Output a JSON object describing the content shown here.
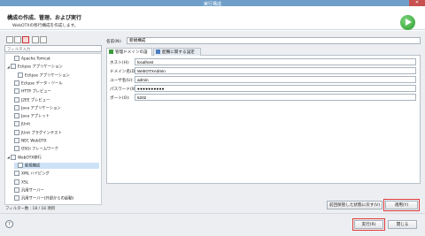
{
  "window": {
    "title": "実行構成",
    "close_glyph": "✕"
  },
  "header": {
    "title": "構成の作成、管理、および実行",
    "subtitle": "WebOTXの移行構成を作成します。"
  },
  "left_pane": {
    "filter_placeholder": "フィルタ入力",
    "tree": [
      {
        "label": "Apache Tomcat",
        "level": 1,
        "twisty": "",
        "icon": "server-icon"
      },
      {
        "label": "Eclipse アプリケーション",
        "level": 0,
        "twisty": "◢",
        "icon": "eclipse-icon"
      },
      {
        "label": "Eclipse アプリケーション",
        "level": 2,
        "twisty": "",
        "icon": "eclipse-icon"
      },
      {
        "label": "Eclipse データ・ツール",
        "level": 1,
        "twisty": "",
        "icon": "data-tools-icon"
      },
      {
        "label": "HTTP プレビュー",
        "level": 1,
        "twisty": "",
        "icon": "http-icon"
      },
      {
        "label": "J2EE プレビュー",
        "level": 1,
        "twisty": "",
        "icon": "j2ee-icon"
      },
      {
        "label": "Java アプリケーション",
        "level": 1,
        "twisty": "",
        "icon": "java-app-icon"
      },
      {
        "label": "Java アプレット",
        "level": 1,
        "twisty": "",
        "icon": "java-applet-icon"
      },
      {
        "label": "JUnit",
        "level": 1,
        "twisty": "",
        "icon": "junit-icon"
      },
      {
        "label": "JUnit プラグインテスト",
        "level": 1,
        "twisty": "",
        "icon": "junit-plugin-icon"
      },
      {
        "label": "NEC WebOTX",
        "level": 1,
        "twisty": "",
        "icon": "nec-icon"
      },
      {
        "label": "OSGi フレームワーク",
        "level": 1,
        "twisty": "",
        "icon": "osgi-icon"
      },
      {
        "label": "WebOTX移行",
        "level": 0,
        "twisty": "◢",
        "icon": "webotx-icon"
      },
      {
        "label": "新規構成",
        "level": 2,
        "twisty": "",
        "icon": "config-icon",
        "selected": true
      },
      {
        "label": "XML ハイピング",
        "level": 1,
        "twisty": "",
        "icon": "xml-icon"
      },
      {
        "label": "XSL",
        "level": 1,
        "twisty": "",
        "icon": "xsl-icon"
      },
      {
        "label": "汎用サーバー",
        "level": 1,
        "twisty": "",
        "icon": "server-icon"
      },
      {
        "label": "汎用サーバー(外部からの起動)",
        "level": 1,
        "twisty": "",
        "icon": "server-icon"
      }
    ],
    "filter_count": "フィルター数 : 18 / 18 項目"
  },
  "right_pane": {
    "name_label": "名前(N):",
    "name_value": "新規構成",
    "tabs": [
      {
        "label": "管理ドメインの設定"
      },
      {
        "label": "配備に関する設定"
      }
    ],
    "fields": [
      {
        "label": "ホスト(H):",
        "value": "localhost"
      },
      {
        "label": "ドメイン名(D):",
        "value": "WebOTXAdmin"
      },
      {
        "label": "ユーザ名(U):",
        "value": "admin"
      },
      {
        "label": "パスワード(W):",
        "value": "●●●●●●●●●●"
      },
      {
        "label": "ポート(O):",
        "value": "6202"
      }
    ],
    "revert_button": "前回保管した状態に戻す(V)",
    "apply_button": "適用(Y)"
  },
  "footer": {
    "help_glyph": "?",
    "run_button": "実行(R)",
    "close_button": "閉じる"
  },
  "colors": {
    "titlebar": "#6f9fc8",
    "accent_red": "#e23b3b",
    "run_green": "#2b9b2b"
  }
}
